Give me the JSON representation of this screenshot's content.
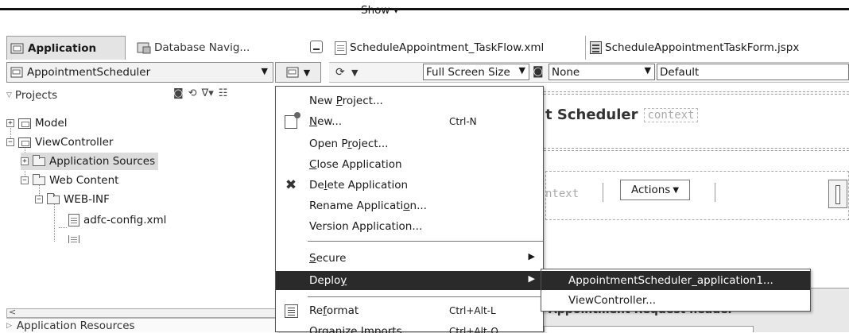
{
  "navigator": {
    "tabs": [
      {
        "label": "Application",
        "active": true
      },
      {
        "label": "Database Navig...",
        "active": false
      }
    ],
    "app_selector": "AppointmentScheduler",
    "projects_label": "Projects",
    "tree": [
      {
        "label": "Model"
      },
      {
        "label": "ViewController"
      },
      {
        "label": "Application Sources"
      },
      {
        "label": "Web Content"
      },
      {
        "label": "WEB-INF"
      },
      {
        "label": "adfc-config.xml"
      }
    ],
    "app_resources_label": "Application Resources"
  },
  "editor": {
    "tabs": [
      {
        "label": "ScheduleAppointment_TaskFlow.xml"
      },
      {
        "label": "ScheduleAppointmentTaskForm.jspx"
      }
    ],
    "toolbar": {
      "show_label": "Show",
      "screen_size": "Full Screen Size",
      "skin": "None",
      "style": "Default"
    },
    "page_title": "t Scheduler",
    "context_tag": "context",
    "context_tag_2": "ntext",
    "actions_label": "Actions",
    "section_header": "Appointment Request header"
  },
  "context_menu": {
    "items": [
      {
        "pre": "New ",
        "u": "P",
        "post": "roject..."
      },
      {
        "pre": "",
        "u": "N",
        "post": "ew...",
        "shortcut": "Ctrl-N"
      },
      {
        "pre": "Open P",
        "u": "r",
        "post": "oject..."
      },
      {
        "pre": "",
        "u": "C",
        "post": "lose Application"
      },
      {
        "pre": "De",
        "u": "l",
        "post": "ete Application"
      },
      {
        "pre": "Rename Applicati",
        "u": "o",
        "post": "n..."
      },
      {
        "pre": "Version Application...",
        "u": "",
        "post": ""
      },
      {
        "pre": "",
        "u": "S",
        "post": "ecure"
      },
      {
        "pre": "Deplo",
        "u": "y",
        "post": ""
      },
      {
        "pre": "Re",
        "u": "f",
        "post": "ormat",
        "shortcut": "Ctrl+Alt-L"
      },
      {
        "pre": "Organize Imports",
        "u": "",
        "post": "",
        "shortcut": "Ctrl+Alt-O"
      }
    ]
  },
  "deploy_submenu": {
    "items": [
      {
        "label": "AppointmentScheduler_application1..."
      },
      {
        "label": "ViewController..."
      }
    ]
  },
  "icons": {
    "new": "new-file-icon",
    "delete": "delete-x-icon",
    "reformat": "reformat-icon"
  },
  "colors": {
    "menu_highlight": "#2a2a2a"
  }
}
